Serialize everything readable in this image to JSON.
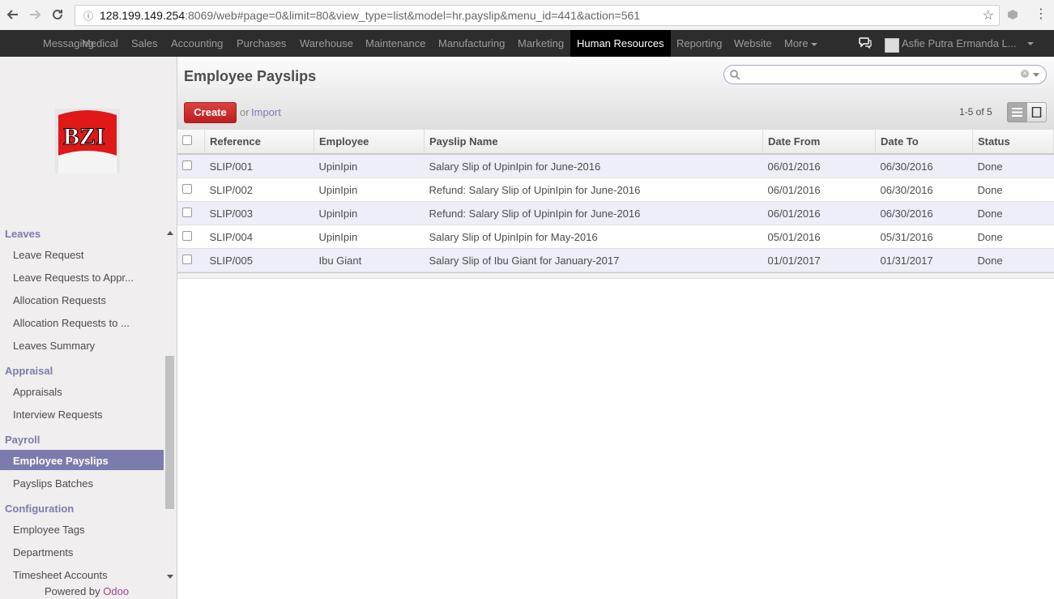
{
  "browser": {
    "url_host": "128.199.149.254",
    "url_rest": ":8069/web#page=0&limit=80&view_type=list&model=hr.payslip&menu_id=441&action=561"
  },
  "topmenu": {
    "items": [
      "Messaging",
      "Medical",
      "Sales",
      "Accounting",
      "Purchases",
      "Warehouse",
      "Maintenance",
      "Manufacturing",
      "Marketing",
      "Human Resources",
      "Reporting",
      "Website",
      "More"
    ],
    "active": "Human Resources",
    "user_name": "Asfie Putra Ermanda L..."
  },
  "sidebar": {
    "sections": [
      {
        "title": "Leaves",
        "items": [
          "Leave Request",
          "Leave Requests to Appr...",
          "Allocation Requests",
          "Allocation Requests to ...",
          "Leaves Summary"
        ]
      },
      {
        "title": "Appraisal",
        "items": [
          "Appraisals",
          "Interview Requests"
        ]
      },
      {
        "title": "Payroll",
        "items": [
          "Employee Payslips",
          "Payslips Batches"
        ]
      },
      {
        "title": "Configuration",
        "items": [
          "Employee Tags",
          "Departments",
          "Timesheet Accounts"
        ]
      }
    ],
    "active_item": "Employee Payslips",
    "powered_by": "Powered by",
    "powered_brand": "Odoo",
    "logo_text": "BZI"
  },
  "control_panel": {
    "title": "Employee Payslips",
    "create_label": "Create",
    "or_text": "or",
    "import_label": "Import",
    "pager": "1-5 of 5",
    "search_value": ""
  },
  "table": {
    "columns": [
      "Reference",
      "Employee",
      "Payslip Name",
      "Date From",
      "Date To",
      "Status"
    ],
    "rows": [
      [
        "SLIP/001",
        "UpinIpin",
        "Salary Slip of UpinIpin for June-2016",
        "06/01/2016",
        "06/30/2016",
        "Done"
      ],
      [
        "SLIP/002",
        "UpinIpin",
        "Refund: Salary Slip of UpinIpin for June-2016",
        "06/01/2016",
        "06/30/2016",
        "Done"
      ],
      [
        "SLIP/003",
        "UpinIpin",
        "Refund: Salary Slip of UpinIpin for June-2016",
        "06/01/2016",
        "06/30/2016",
        "Done"
      ],
      [
        "SLIP/004",
        "UpinIpin",
        "Salary Slip of UpinIpin for May-2016",
        "05/01/2016",
        "05/31/2016",
        "Done"
      ],
      [
        "SLIP/005",
        "Ibu Giant",
        "Salary Slip of Ibu Giant for January-2017",
        "01/01/2017",
        "01/31/2017",
        "Done"
      ]
    ]
  },
  "colors": {
    "accent": "#7c7bad",
    "create_button": "#c9302c",
    "topbar": "#2d2d2d",
    "brand_odoo": "#a24689"
  }
}
